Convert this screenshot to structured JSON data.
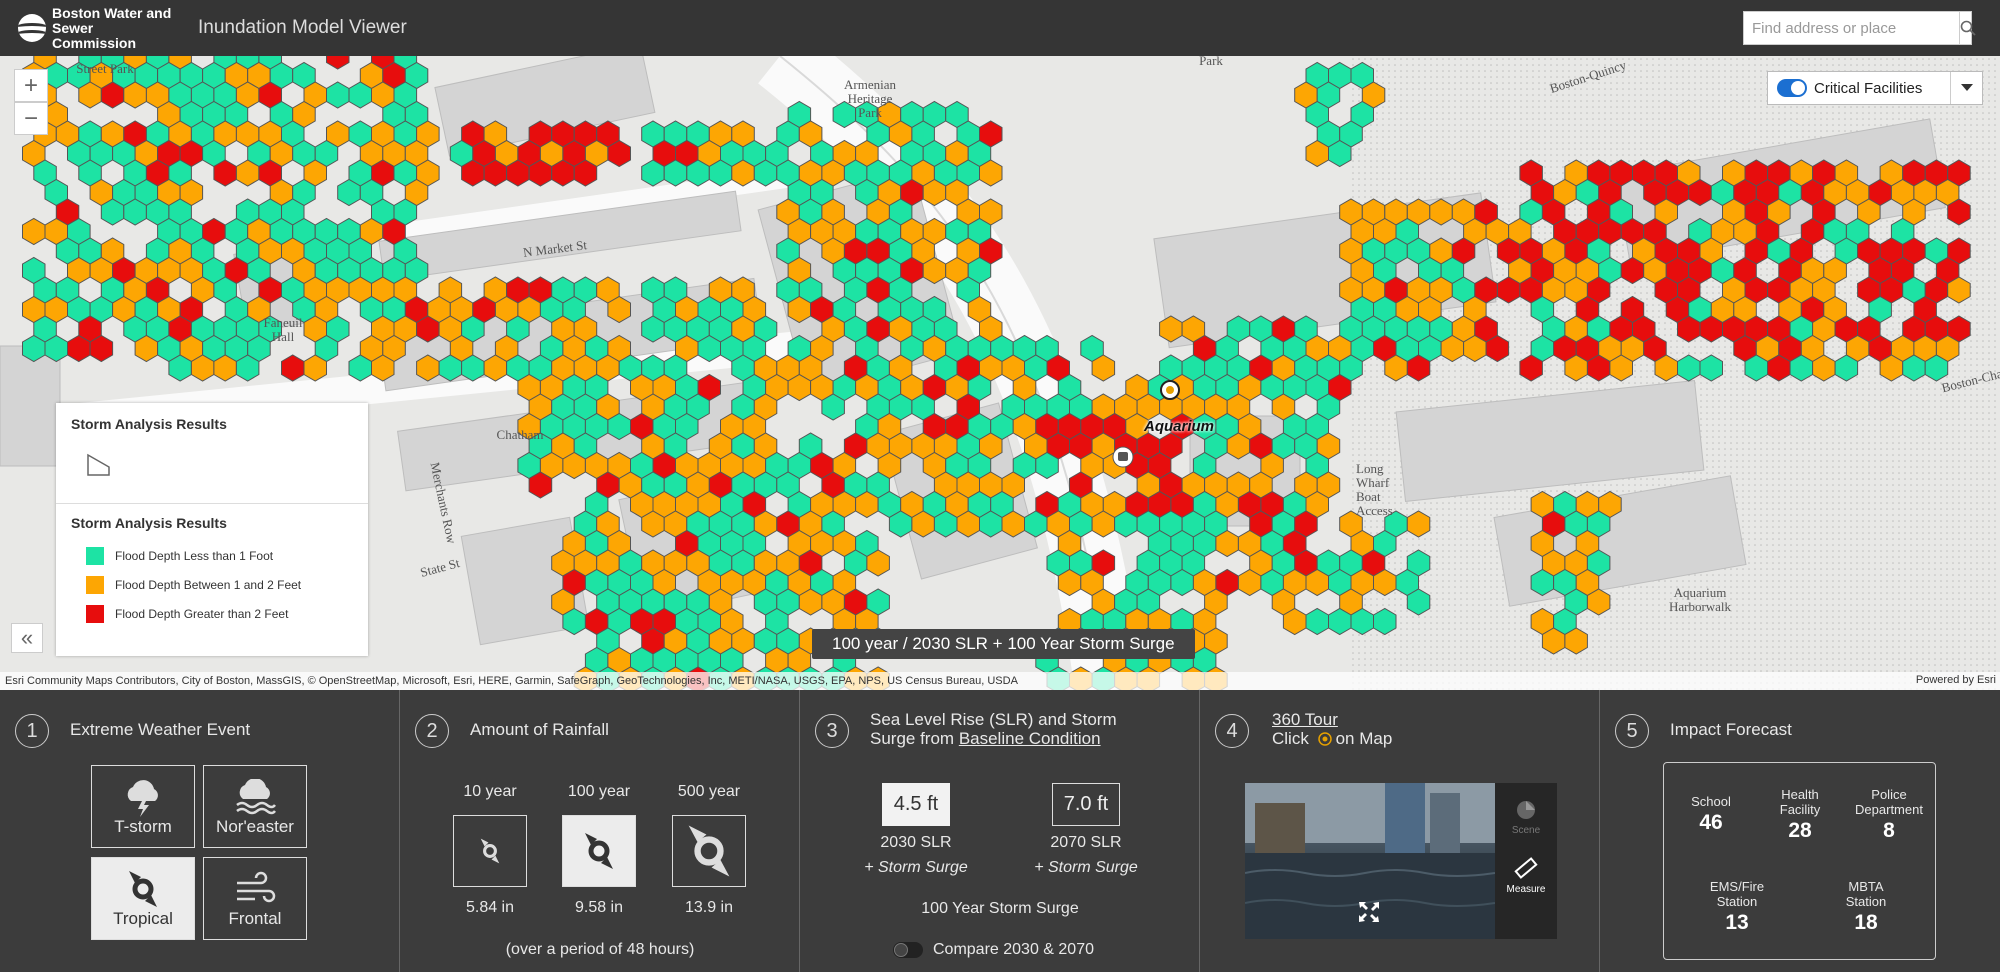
{
  "header": {
    "logo_line1": "Boston Water and",
    "logo_line2": "Sewer Commission",
    "app_title": "Inundation Model Viewer",
    "search_placeholder": "Find address or place"
  },
  "map": {
    "zoom_in": "+",
    "zoom_out": "−",
    "layers_toggle_label": "Critical Facilities",
    "place_labels": [
      "Street Park",
      "Armenian Heritage Park",
      "Park",
      "Boston-Quincy",
      "N Market St",
      "Faneuil Hall",
      "Chatham",
      "Merchants Row",
      "State St",
      "Aquarium",
      "Long Wharf Boat Access",
      "Boston-Cha",
      "Aquarium Harborwalk"
    ],
    "scenario_label": "100 year / 2030 SLR + 100 Year Storm Surge",
    "attribution": "Esri Community Maps Contributors, City of Boston, MassGIS, © OpenStreetMap, Microsoft, Esri, HERE, Garmin, SafeGraph, GeoTechnologies, Inc, METI/NASA, USGS, EPA, NPS, US Census Bureau, USDA",
    "powered_by": "Powered by Esri",
    "colors": {
      "low": "#1de3a4",
      "mid": "#fda603",
      "high": "#e70d0d"
    }
  },
  "legend": {
    "title1": "Storm Analysis Results",
    "title2": "Storm Analysis Results",
    "items": [
      {
        "label": "Flood Depth Less than 1 Foot",
        "color": "#1de3a4"
      },
      {
        "label": "Flood Depth Between 1 and 2 Feet",
        "color": "#fda603"
      },
      {
        "label": "Flood Depth Greater than 2 Feet",
        "color": "#e70d0d"
      }
    ]
  },
  "panels": {
    "weather": {
      "num": "1",
      "title": "Extreme Weather Event",
      "buttons": [
        {
          "label": "T-storm",
          "icon": "thunderstorm-icon",
          "selected": false
        },
        {
          "label": "Nor'easter",
          "icon": "noreaster-icon",
          "selected": false
        },
        {
          "label": "Tropical",
          "icon": "hurricane-icon",
          "selected": true
        },
        {
          "label": "Frontal",
          "icon": "wind-icon",
          "selected": false
        }
      ]
    },
    "rainfall": {
      "num": "2",
      "title": "Amount of Rainfall",
      "options": [
        {
          "period": "10 year",
          "amount": "5.84 in",
          "selected": false
        },
        {
          "period": "100 year",
          "amount": "9.58 in",
          "selected": true
        },
        {
          "period": "500 year",
          "amount": "13.9 in",
          "selected": false
        }
      ],
      "note": "(over a period of 48 hours)"
    },
    "slr": {
      "num": "3",
      "title_line1": "Sea Level Rise (SLR) and Storm",
      "title_line2_prefix": "Surge from ",
      "title_link": "Baseline Condition",
      "options": [
        {
          "value": "4.5 ft",
          "label": "2030 SLR",
          "sub": "+ Storm Surge",
          "selected": true
        },
        {
          "value": "7.0 ft",
          "label": "2070 SLR",
          "sub": "+ Storm Surge",
          "selected": false
        }
      ],
      "surge_label": "100 Year Storm Surge",
      "compare_label": "Compare 2030 & 2070"
    },
    "tour": {
      "num": "4",
      "link": "360 Tour",
      "hint_prefix": "Click",
      "hint_suffix": "on Map",
      "tool_scene": "Scene",
      "tool_measure": "Measure"
    },
    "impact": {
      "num": "5",
      "title": "Impact Forecast",
      "items": [
        {
          "label": "School",
          "value": "46"
        },
        {
          "label": "Health Facility",
          "value": "28"
        },
        {
          "label": "Police Department",
          "value": "8"
        },
        {
          "label": "EMS/Fire Station",
          "value": "13"
        },
        {
          "label": "MBTA Station",
          "value": "18"
        }
      ]
    }
  }
}
